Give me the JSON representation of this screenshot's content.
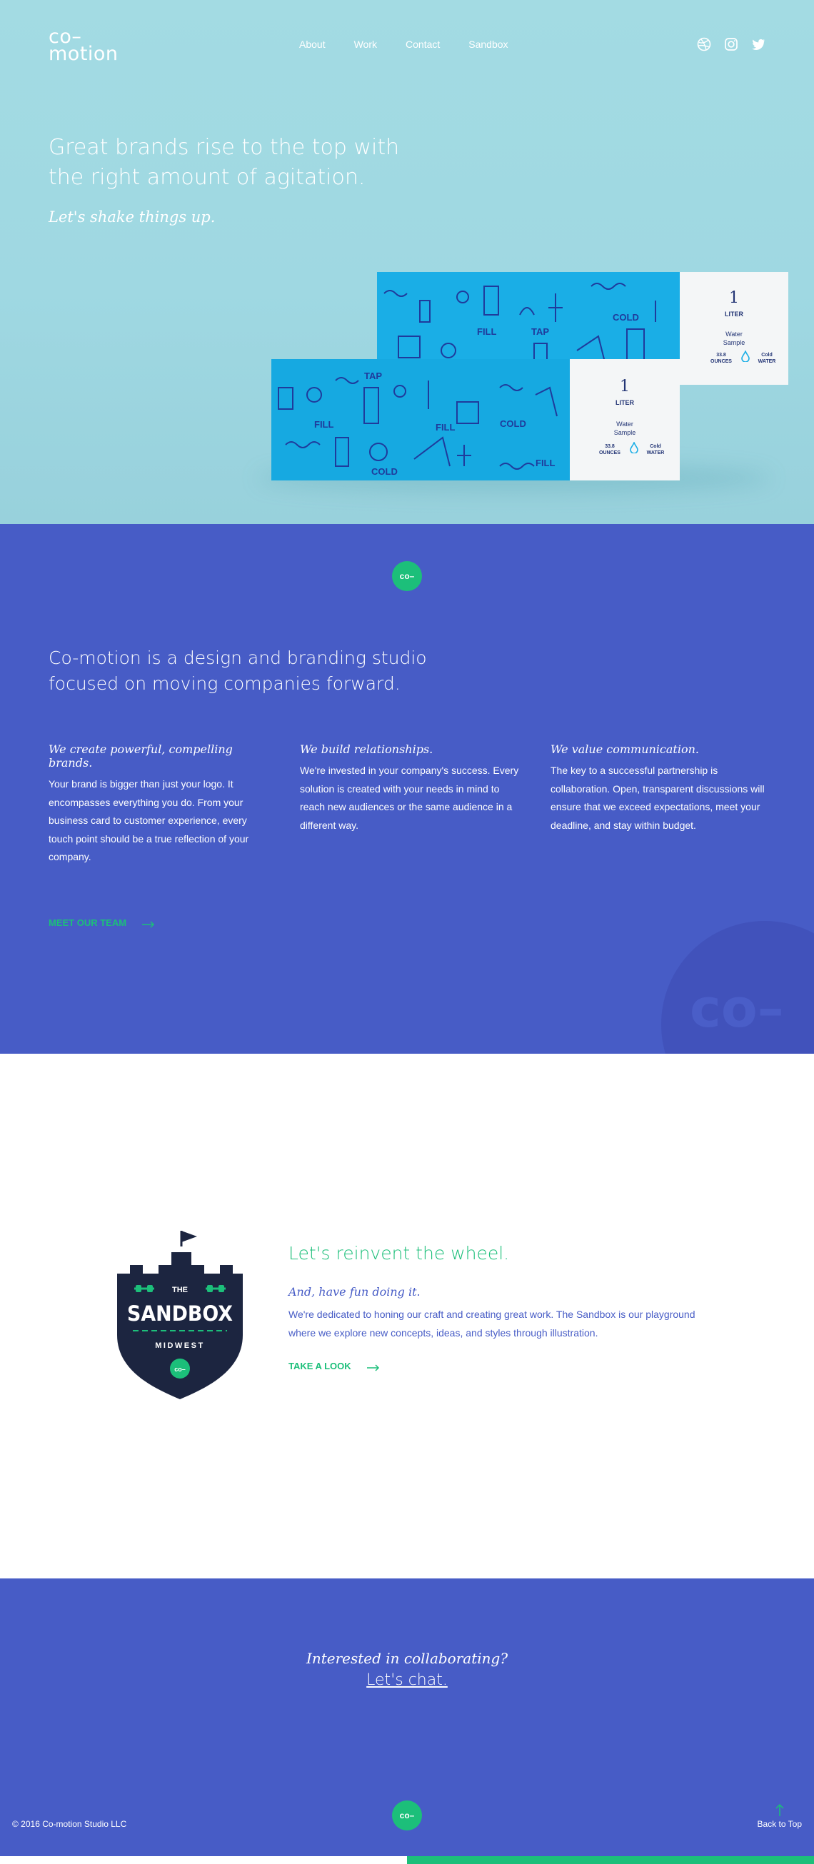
{
  "header": {
    "logo_line1": "co–",
    "logo_line2": "motion",
    "nav": [
      "About",
      "Work",
      "Contact",
      "Sandbox"
    ],
    "social_icons": [
      "dribbble-icon",
      "instagram-icon",
      "twitter-icon"
    ]
  },
  "hero": {
    "title": "Great brands rise to the top with the right amount of agitation.",
    "subtitle": "Let's shake things up.",
    "box_label": {
      "number": "1",
      "unit": "LITER",
      "line1": "Water",
      "line2": "Sample",
      "ounces_val": "33.8",
      "ounces": "OUNCES",
      "cold": "Cold",
      "water": "WATER"
    }
  },
  "about": {
    "badge": "co–",
    "title": "Co-motion is a design and branding studio focused on moving companies forward.",
    "columns": [
      {
        "heading": "We create powerful, compelling brands.",
        "body": "Your brand is bigger than just your logo. It encompasses everything you do. From your business card to customer experience, every touch point should be a true reflection of your company."
      },
      {
        "heading": "We build relationships.",
        "body": "We're invested in your company's success. Every solution is created with your needs in mind to reach new audiences or the same audience in a different way."
      },
      {
        "heading": "We value communication.",
        "body": "The key to a successful partnership is collaboration. Open, transparent discussions will ensure that we exceed expectations, meet your deadline, and stay within budget."
      }
    ],
    "cta": "MEET OUR TEAM",
    "watermark": "co–"
  },
  "sandbox": {
    "badge_the": "THE",
    "badge_name": "SANDBOX",
    "badge_place": "MIDWEST",
    "badge_logo": "co–",
    "title": "Let's reinvent the wheel.",
    "subtitle": "And, have fun doing it.",
    "body": "We're dedicated to honing our craft and creating great work. The Sandbox is our playground where we explore new concepts, ideas, and styles through illustration.",
    "cta": "TAKE A LOOK"
  },
  "footer": {
    "question": "Interested in collaborating?",
    "link": "Let's chat.",
    "badge": "co–",
    "copyright": "© 2016 Co-motion Studio LLC",
    "back_to_top": "Back to Top"
  },
  "colors": {
    "hero_bg": "#a3dbe3",
    "brand_blue": "#475cc6",
    "accent_green": "#1cbf7a",
    "box_blue": "#1aaee6"
  }
}
